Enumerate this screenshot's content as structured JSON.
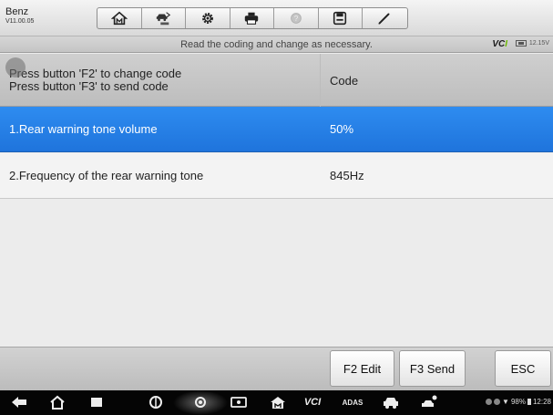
{
  "vehicle": {
    "make": "Benz",
    "version": "V11.00.05"
  },
  "toolbar": {
    "buttons": [
      {
        "name": "home",
        "icon": "home-icon"
      },
      {
        "name": "vehicle-swap",
        "icon": "car-swap-icon"
      },
      {
        "name": "settings",
        "icon": "gear-icon"
      },
      {
        "name": "print",
        "icon": "printer-icon"
      },
      {
        "name": "help",
        "icon": "help-icon",
        "disabled": true
      },
      {
        "name": "save",
        "icon": "save-icon"
      },
      {
        "name": "edit",
        "icon": "pencil-icon"
      }
    ]
  },
  "info_strip": {
    "instruction": "Read the coding and change as necessary.",
    "vci_label": "VCI",
    "voltage": "12.15V"
  },
  "table": {
    "header_left_line1": "Press button 'F2' to change code",
    "header_left_line2": "Press button 'F3' to send code",
    "header_right": "Code",
    "rows": [
      {
        "name": "1.Rear warning tone volume",
        "value": "50%",
        "selected": true
      },
      {
        "name": "2.Frequency of the rear warning tone",
        "value": "845Hz",
        "selected": false
      }
    ]
  },
  "function_bar": {
    "f2_label": "F2 Edit",
    "f3_label": "F3 Send",
    "esc_label": "ESC"
  },
  "nav_bar": {
    "vci_label": "VCI",
    "adas_label": "ADAS",
    "battery_percent": "98%",
    "time": "12:28"
  },
  "colors": {
    "selected_row": "#1f74dc",
    "vci_accent": "#6cb800",
    "nav_background": "#050505"
  }
}
